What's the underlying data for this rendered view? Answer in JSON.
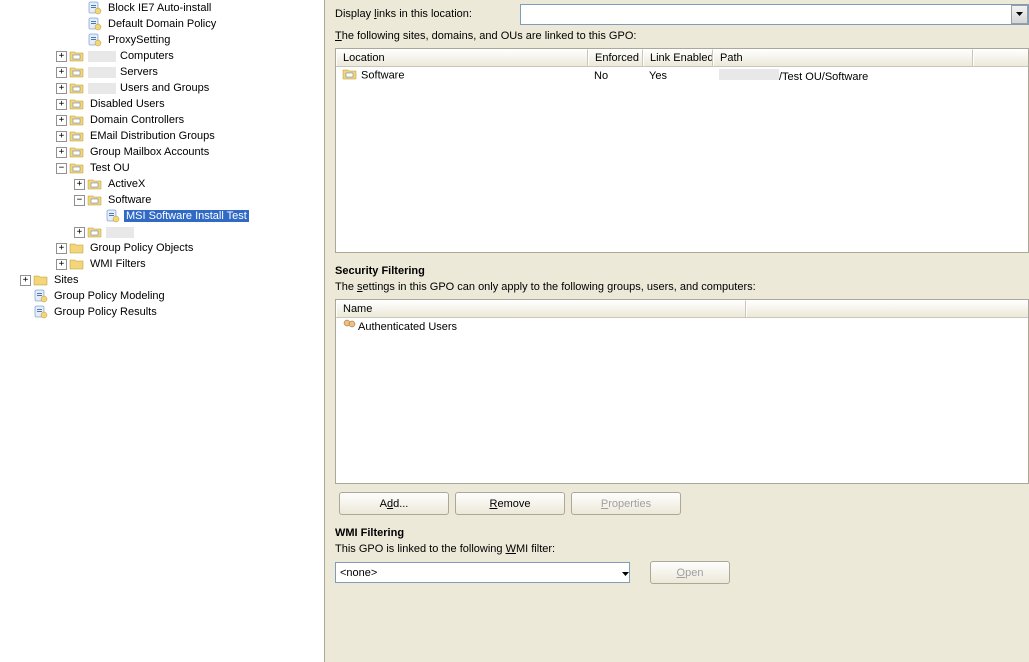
{
  "tree_items": [
    {
      "indent": 3,
      "expand": "none",
      "icon": "gpo",
      "label": "Block IE7 Auto-install",
      "interact": true
    },
    {
      "indent": 3,
      "expand": "none",
      "icon": "gpo",
      "label": "Default Domain Policy",
      "interact": true
    },
    {
      "indent": 3,
      "expand": "none",
      "icon": "gpo",
      "label": "ProxySetting",
      "interact": true
    },
    {
      "indent": 2,
      "expand": "plus",
      "icon": "ou",
      "label": "Computers",
      "blur": true,
      "interact": true
    },
    {
      "indent": 2,
      "expand": "plus",
      "icon": "ou",
      "label": "Servers",
      "blur": true,
      "interact": true
    },
    {
      "indent": 2,
      "expand": "plus",
      "icon": "ou",
      "label": "Users and Groups",
      "blur": true,
      "interact": true
    },
    {
      "indent": 2,
      "expand": "plus",
      "icon": "ou",
      "label": "Disabled Users",
      "interact": true
    },
    {
      "indent": 2,
      "expand": "plus",
      "icon": "ou",
      "label": "Domain Controllers",
      "interact": true
    },
    {
      "indent": 2,
      "expand": "plus",
      "icon": "ou",
      "label": "EMail Distribution Groups",
      "interact": true
    },
    {
      "indent": 2,
      "expand": "plus",
      "icon": "ou",
      "label": "Group Mailbox Accounts",
      "interact": true
    },
    {
      "indent": 2,
      "expand": "minus",
      "icon": "ou",
      "label": "Test OU",
      "interact": true
    },
    {
      "indent": 3,
      "expand": "plus",
      "icon": "ou",
      "label": "ActiveX",
      "interact": true
    },
    {
      "indent": 3,
      "expand": "minus",
      "icon": "ou",
      "label": "Software",
      "interact": true
    },
    {
      "indent": 4,
      "expand": "none",
      "icon": "gpo",
      "label": "MSI Software Install Test",
      "selected": true,
      "interact": true
    },
    {
      "indent": 3,
      "expand": "plus",
      "icon": "ou",
      "label": "",
      "blur": true,
      "interact": true
    },
    {
      "indent": 2,
      "expand": "plus",
      "icon": "folder",
      "label": "Group Policy Objects",
      "interact": true
    },
    {
      "indent": 2,
      "expand": "plus",
      "icon": "folder",
      "label": "WMI Filters",
      "interact": true
    },
    {
      "indent": 0,
      "expand": "plus",
      "icon": "folder",
      "label": "Sites",
      "interact": true
    },
    {
      "indent": 0,
      "expand": "none",
      "icon": "gpo-mod",
      "label": "Group Policy Modeling",
      "interact": true
    },
    {
      "indent": 0,
      "expand": "none",
      "icon": "gpo-res",
      "label": "Group Policy Results",
      "interact": true
    }
  ],
  "display_links_label_pre": "Display ",
  "display_links_label_u": "l",
  "display_links_label_post": "inks in this location:",
  "display_links_value": "",
  "following_sites_pre": "",
  "following_sites_u": "T",
  "following_sites_post": "he following sites, domains, and OUs are linked to this GPO:",
  "links_headers": {
    "location": "Location",
    "enforced": "Enforced",
    "link_enabled": "Link Enabled",
    "path": "Path"
  },
  "links_rows": [
    {
      "location": "Software",
      "enforced": "No",
      "link_enabled": "Yes",
      "path_prefix": "",
      "path_visible": "/Test OU/Software"
    }
  ],
  "security_filtering_title": "Security Filtering",
  "security_filtering_desc_pre": "The ",
  "security_filtering_desc_u": "s",
  "security_filtering_desc_post": "ettings in this GPO can only apply to the following groups, users, and computers:",
  "security_headers": {
    "name": "Name"
  },
  "security_rows": [
    {
      "name": "Authenticated Users"
    }
  ],
  "buttons": {
    "add_pre": "A",
    "add_u": "d",
    "add_post": "d...",
    "remove_u": "R",
    "remove_post": "emove",
    "properties_u": "P",
    "properties_post": "roperties"
  },
  "wmi_title": "WMI Filtering",
  "wmi_desc_pre": "This GPO is linked to the following ",
  "wmi_desc_u": "W",
  "wmi_desc_post": "MI filter:",
  "wmi_value": "<none>",
  "wmi_open_u": "O",
  "wmi_open_post": "pen"
}
